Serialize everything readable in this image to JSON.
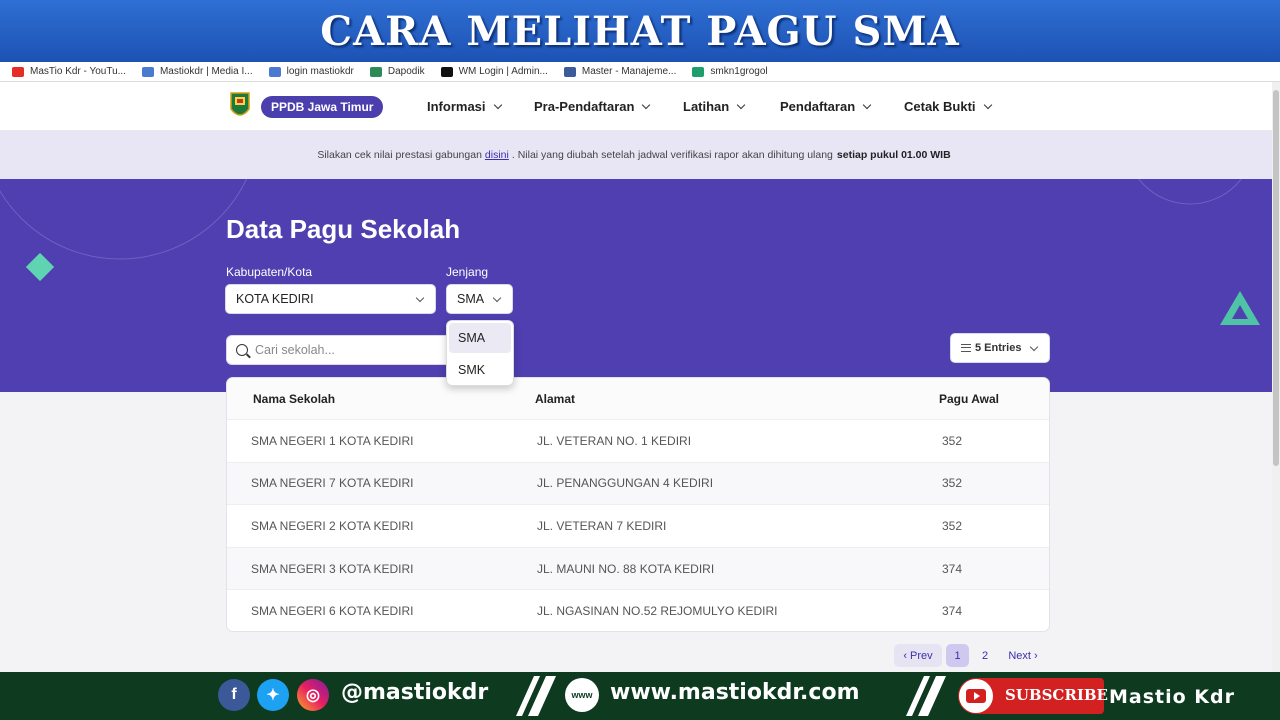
{
  "banner": {
    "title": "CARA MELIHAT PAGU SMA"
  },
  "bookmarks": [
    {
      "label": "MasTio Kdr - YouTu...",
      "color": "#e52d27"
    },
    {
      "label": "Mastiokdr | Media I...",
      "color": "#4a7bd1"
    },
    {
      "label": "login mastiokdr",
      "color": "#4a7bd1"
    },
    {
      "label": "Dapodik",
      "color": "#2e8b57"
    },
    {
      "label": "WM Login | Admin...",
      "color": "#111111"
    },
    {
      "label": "Master - Manajeme...",
      "color": "#3b5b9a"
    },
    {
      "label": "smkn1grogol",
      "color": "#1f9e6d"
    }
  ],
  "navbar": {
    "brand": "PPDB Jawa Timur",
    "items": [
      "Informasi",
      "Pra-Pendaftaran",
      "Latihan",
      "Pendaftaran",
      "Cetak Bukti"
    ]
  },
  "notice": {
    "before": "Silakan cek nilai prestasi gabungan",
    "link": "disini",
    "middle": ". Nilai yang diubah setelah jadwal verifikasi rapor akan dihitung ulang",
    "bold": "setiap pukul 01.00 WIB"
  },
  "hero": {
    "title": "Data Pagu Sekolah"
  },
  "filters": {
    "kabupaten_label": "Kabupaten/Kota",
    "kabupaten_value": "KOTA KEDIRI",
    "jenjang_label": "Jenjang",
    "jenjang_value": "SMA",
    "jenjang_options": [
      "SMA",
      "SMK"
    ]
  },
  "search": {
    "placeholder": "Cari sekolah..."
  },
  "entries": {
    "label": "5 Entries"
  },
  "table": {
    "headers": [
      "Nama Sekolah",
      "Alamat",
      "Pagu Awal"
    ],
    "rows": [
      [
        "SMA NEGERI 1 KOTA KEDIRI",
        "JL. VETERAN NO. 1 KEDIRI",
        "352"
      ],
      [
        "SMA NEGERI 7 KOTA KEDIRI",
        "JL. PENANGGUNGAN 4 KEDIRI",
        "352"
      ],
      [
        "SMA NEGERI 2 KOTA KEDIRI",
        "JL. VETERAN 7 KEDIRI",
        "352"
      ],
      [
        "SMA NEGERI 3 KOTA KEDIRI",
        "JL. MAUNI NO. 88 KOTA KEDIRI",
        "374"
      ],
      [
        "SMA NEGERI 6 KOTA KEDIRI",
        "JL. NGASINAN NO.52 REJOMULYO KEDIRI",
        "374"
      ]
    ]
  },
  "pagination": {
    "prev": "‹ Prev",
    "pages": [
      "1",
      "2"
    ],
    "next": "Next ›",
    "current": "1"
  },
  "footer": {
    "handle": "@mastiokdr",
    "website": "www.mastiokdr.com",
    "subscribe": "SUBSCRIBE",
    "channel": "Mastio Kdr"
  },
  "colors": {
    "primary": "#4f3fb0",
    "banner": "#2f6fd3",
    "footer": "#0e3a20"
  }
}
